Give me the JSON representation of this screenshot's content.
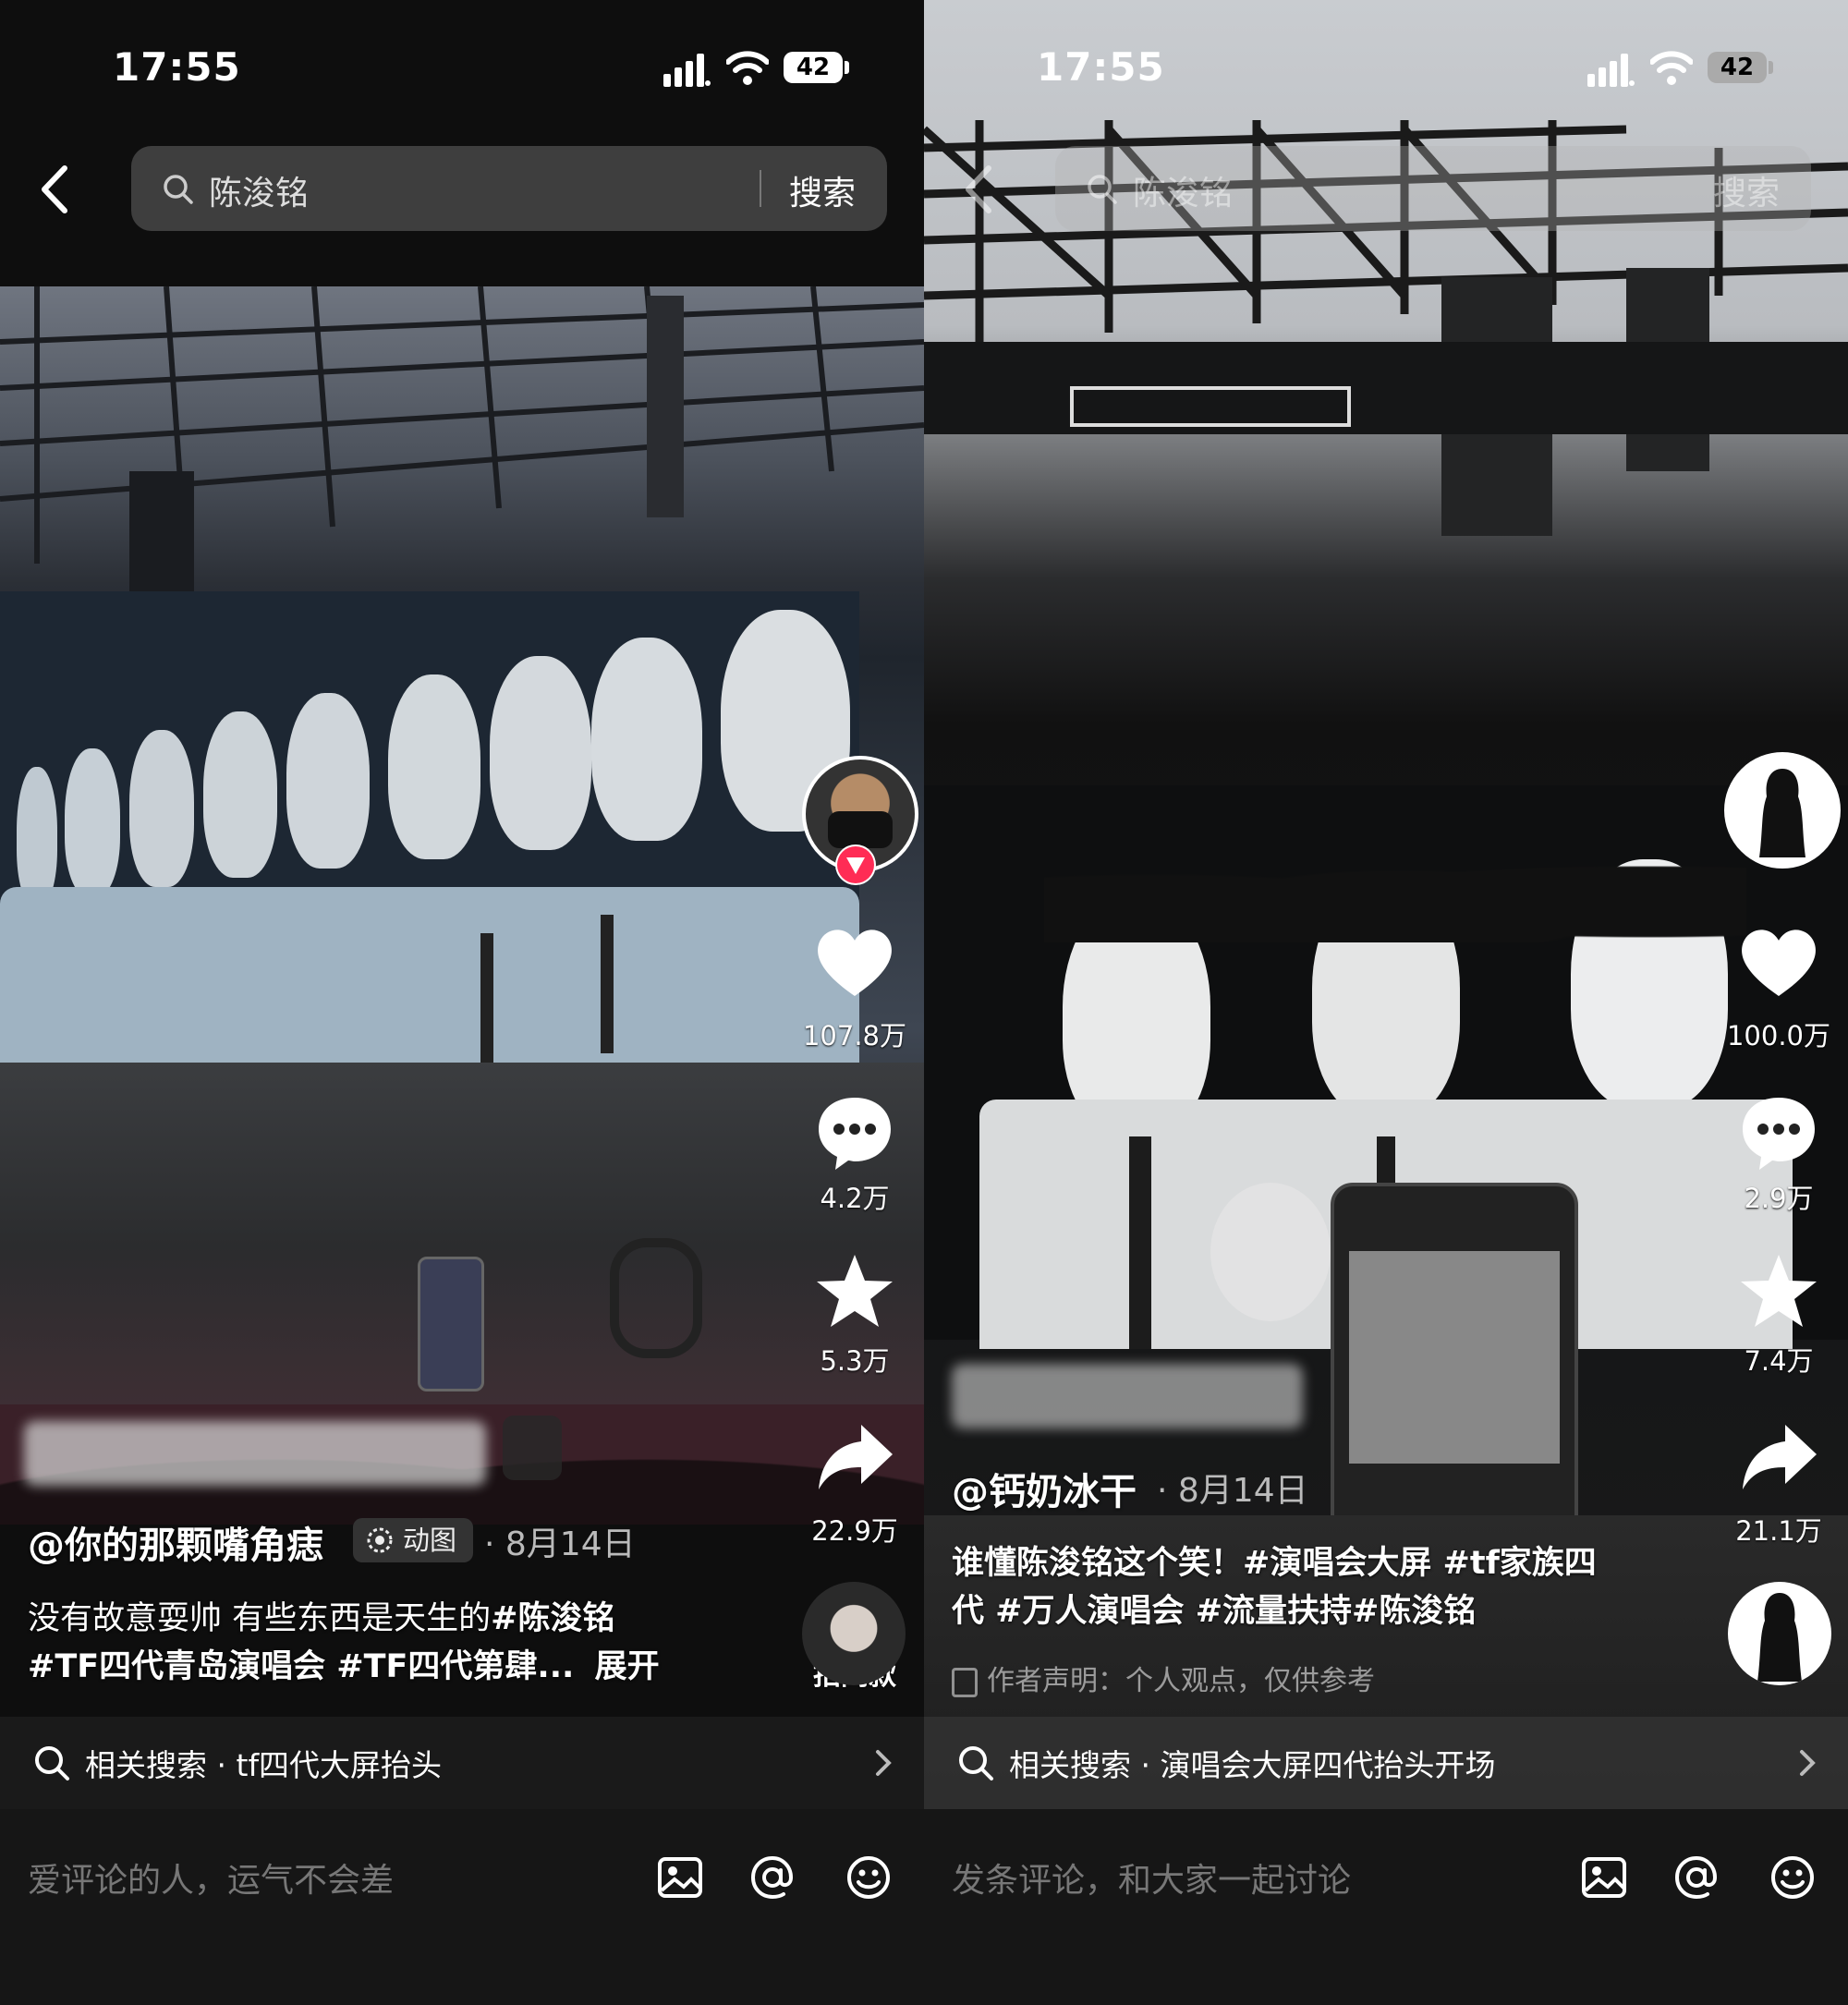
{
  "status_bar": {
    "time": "17:55",
    "battery": "42"
  },
  "colors": {
    "follow_red": "#ff2c55",
    "text_muted": "#777777",
    "bg": "#0e0e0e"
  },
  "left": {
    "search": {
      "query": "陈浚铭",
      "button": "搜索"
    },
    "author": "@你的那颗嘴角痣",
    "tag": "动图",
    "date": "· 8月14日",
    "caption_line1_text": "没有故意耍帅 有些东西是天生的",
    "caption_line1_tag": "#陈浚铭",
    "caption_line2": "#TF四代青岛演唱会 #TF四代第肆...",
    "expand": "展开",
    "actions": {
      "likes": "107.8万",
      "comments": "4.2万",
      "favorites": "5.3万",
      "shares": "22.9万"
    },
    "same_style": "拍同款",
    "related": {
      "label": "相关搜索",
      "sep": "·",
      "query": "tf四代大屏抬头"
    },
    "comment_placeholder": "爱评论的人，运气不会差"
  },
  "right": {
    "search": {
      "query": "陈浚铭",
      "button": "搜索"
    },
    "author": "@钙奶冰干",
    "date": "· 8月14日",
    "caption_line1": "谁懂陈浚铭这个笑！#演唱会大屏 #tf家族四",
    "caption_line2": "代 #万人演唱会 #流量扶持#陈浚铭",
    "disclaimer": "作者声明：个人观点，仅供参考",
    "actions": {
      "likes": "100.0万",
      "comments": "2.9万",
      "favorites": "7.4万",
      "shares": "21.1万"
    },
    "related": {
      "label": "相关搜索",
      "sep": "·",
      "query": "演唱会大屏四代抬头开场"
    },
    "comment_placeholder": "发条评论，和大家一起讨论"
  },
  "icons": [
    "back-icon",
    "search-icon",
    "heart-icon",
    "comment-bubble-icon",
    "star-icon",
    "share-arrow-icon",
    "image-icon",
    "at-icon",
    "emoji-icon",
    "chevron-right-icon",
    "signal-icon",
    "wifi-icon",
    "battery-icon"
  ]
}
